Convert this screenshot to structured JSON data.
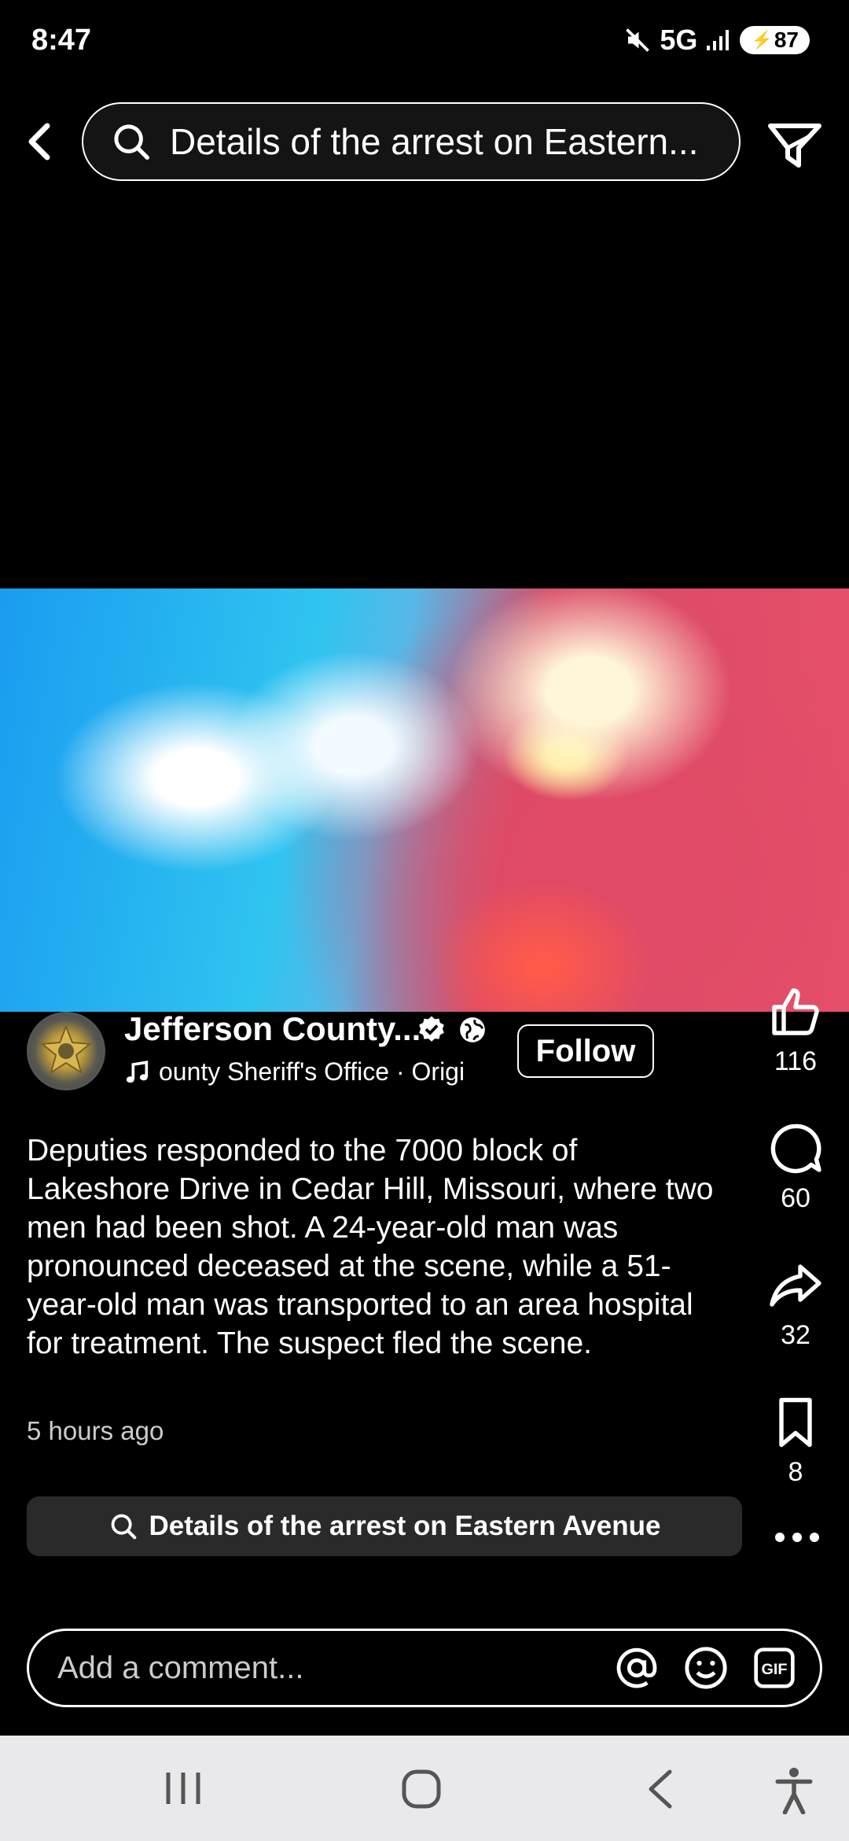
{
  "status_bar": {
    "time": "8:47",
    "network": "5G",
    "battery": "87"
  },
  "search": {
    "query": "Details of the arrest on Eastern..."
  },
  "post": {
    "author": "Jefferson County...",
    "audio": "ounty Sheriff's Office · Origi",
    "follow_label": "Follow",
    "caption": "Deputies responded to the 7000 block of Lakeshore Drive in Cedar Hill, Missouri, where two men had been shot. A 24-year-old man was pronounced deceased at the scene, while a 51-year-old man was transported to an area hospital for treatment. The suspect fled the scene.",
    "timestamp": "5 hours ago",
    "related_search": "Details of the arrest on Eastern Avenue"
  },
  "actions": {
    "likes": "116",
    "comments": "60",
    "shares": "32",
    "saves": "8"
  },
  "comment": {
    "placeholder": "Add a comment..."
  },
  "icons": {
    "back": "back-arrow-icon",
    "search": "search-icon",
    "filter": "filter-icon",
    "verified": "verified-badge-icon",
    "globe": "globe-icon",
    "music": "music-note-icon",
    "like": "thumbs-up-icon",
    "comment": "comment-bubble-icon",
    "share": "share-arrow-icon",
    "save": "bookmark-icon",
    "more": "more-dots-icon",
    "mention": "at-sign-icon",
    "emoji": "emoji-icon",
    "gif": "gif-icon"
  }
}
